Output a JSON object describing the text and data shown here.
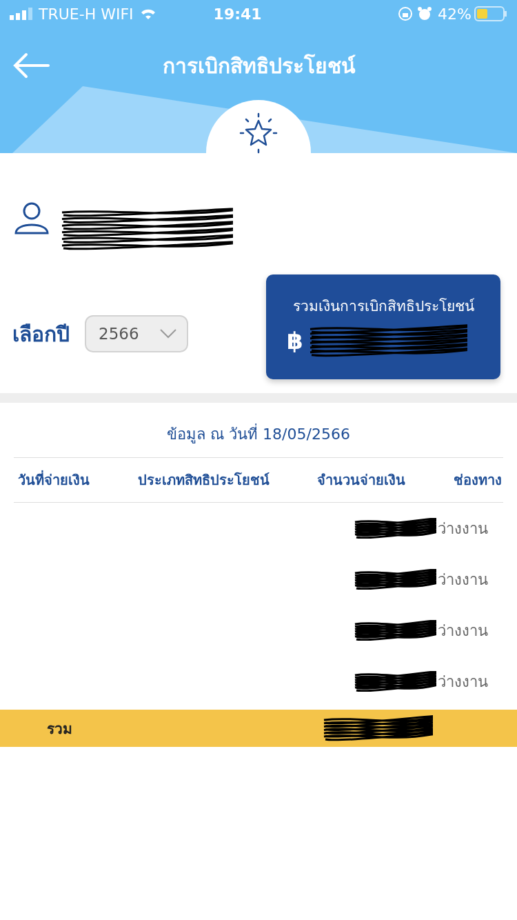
{
  "status_bar": {
    "carrier": "TRUE-H WIFI",
    "time": "19:41",
    "battery": "42%"
  },
  "header": {
    "title": "การเบิกสิทธิประโยชน์"
  },
  "user": {
    "redacted": true
  },
  "year_picker": {
    "label": "เลือกปี",
    "value": "2566"
  },
  "total_card": {
    "label": "รวมเงินการเบิกสิทธิประโยชน์",
    "currency": "฿",
    "redacted": true
  },
  "as_of": "ข้อมูล ณ วันที่ 18/05/2566",
  "table": {
    "columns": [
      "วันที่จ่ายเงิน",
      "ประเภทสิทธิประโยชน์",
      "จำนวนจ่ายเงิน",
      "ช่องทาง"
    ],
    "rows": [
      {
        "channel": "ว่างงาน",
        "amount_redacted": true
      },
      {
        "channel": "ว่างงาน",
        "amount_redacted": true
      },
      {
        "channel": "ว่างงาน",
        "amount_redacted": true
      },
      {
        "channel": "ว่างงาน",
        "amount_redacted": true
      }
    ],
    "total": {
      "label": "รวม",
      "amount_redacted": true
    }
  }
}
